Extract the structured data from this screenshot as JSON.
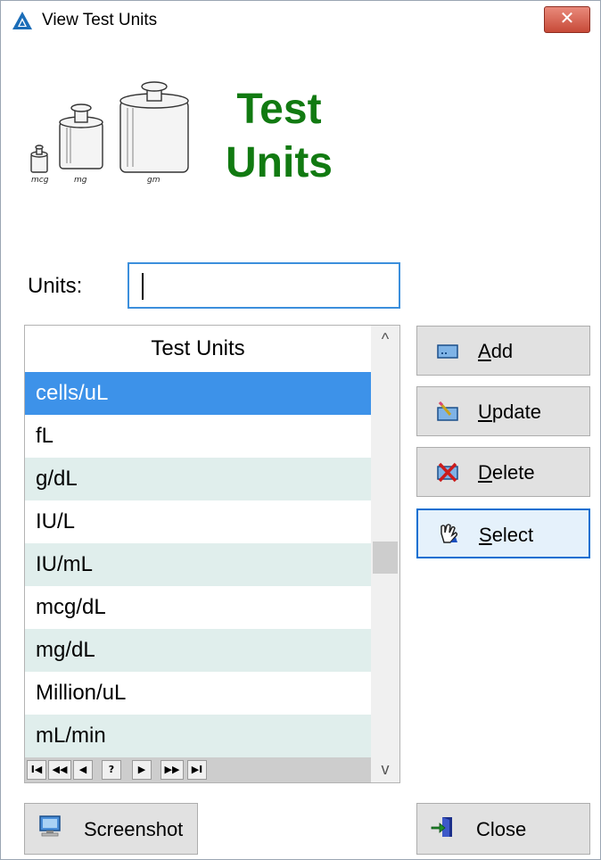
{
  "window": {
    "title": "View Test Units",
    "close_glyph": "✕"
  },
  "header": {
    "heading_line1": "Test",
    "heading_line2": "Units",
    "image_labels": [
      "mcg",
      "mg",
      "gm"
    ]
  },
  "units_field": {
    "label": "Units:",
    "value": ""
  },
  "grid": {
    "column_header": "Test Units",
    "rows": [
      "cells/uL",
      "fL",
      "g/dL",
      "IU/L",
      "IU/mL",
      "mcg/dL",
      "mg/dL",
      "Million/uL",
      "mL/min"
    ],
    "selected_index": 0,
    "navigator": [
      "I◀",
      "◀◀",
      "◀",
      "?",
      "▶",
      "▶▶",
      "▶I"
    ]
  },
  "buttons": {
    "add": {
      "accel": "A",
      "rest": "dd"
    },
    "update": {
      "accel": "U",
      "rest": "pdate"
    },
    "delete": {
      "accel": "D",
      "rest": "elete"
    },
    "select": {
      "accel": "S",
      "rest": "elect"
    },
    "screenshot": "Screenshot",
    "close": "Close"
  },
  "icons": {
    "app": "triangle-logo-icon",
    "add": "add-record-icon",
    "update": "edit-record-icon",
    "delete": "delete-record-icon",
    "select": "hand-pointer-icon",
    "screenshot": "monitor-icon",
    "close": "exit-door-icon"
  },
  "colors": {
    "heading": "#117a11",
    "selection": "#3d92e9",
    "alt_row": "#e0eeec",
    "focus": "#0a6fd1"
  }
}
